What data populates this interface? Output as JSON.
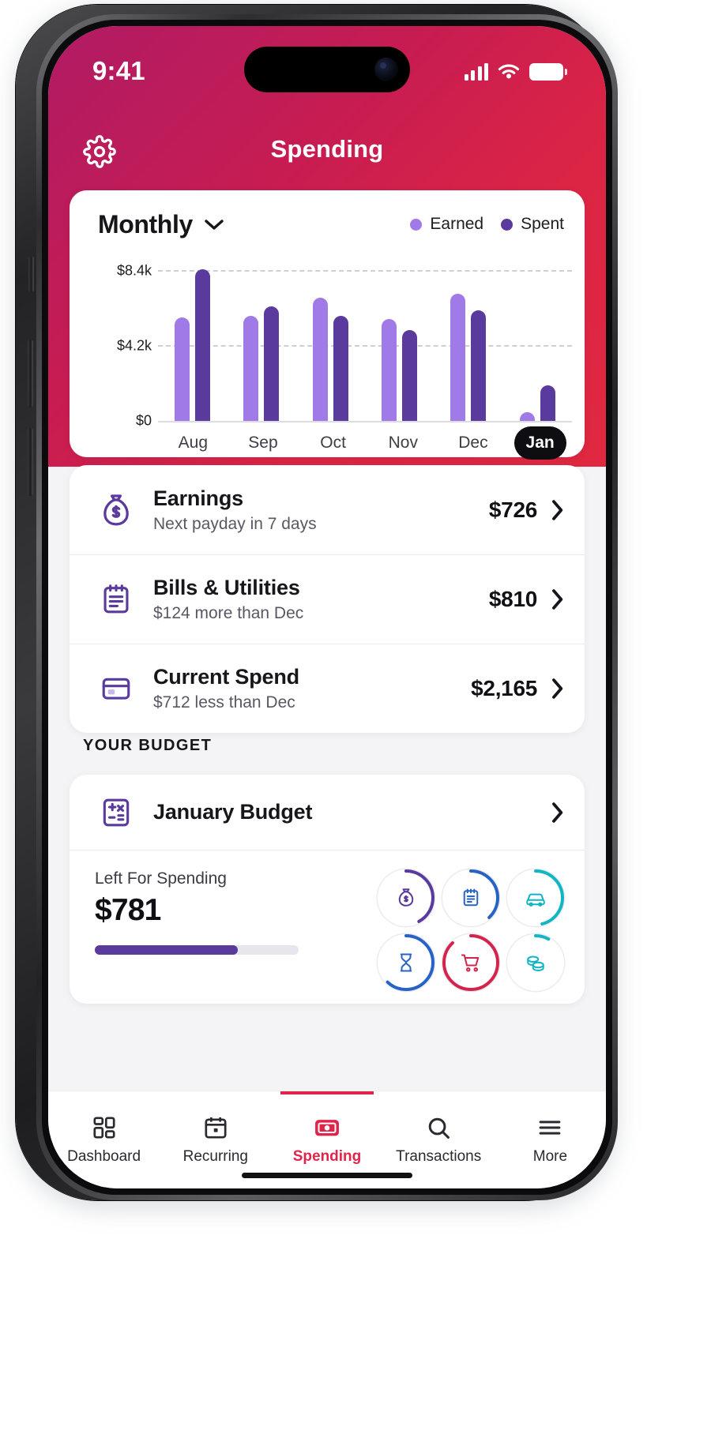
{
  "status_bar": {
    "time": "9:41",
    "signal_icon": "cellular-bars-icon",
    "wifi_icon": "wifi-icon",
    "battery_icon": "battery-icon"
  },
  "nav": {
    "title": "Spending",
    "settings_icon": "gear-icon"
  },
  "chart_card": {
    "period_label": "Monthly",
    "period_chevron_icon": "chevron-down-icon",
    "legend": [
      {
        "label": "Earned",
        "color": "#a07ae6"
      },
      {
        "label": "Spent",
        "color": "#5b3a9e"
      }
    ]
  },
  "chart_data": {
    "type": "bar",
    "title": "Monthly",
    "categories": [
      "Aug",
      "Sep",
      "Oct",
      "Nov",
      "Dec",
      "Jan"
    ],
    "series": [
      {
        "name": "Earned",
        "color": "#a07ae6",
        "values": [
          5800,
          5900,
          6900,
          5700,
          7100,
          500
        ]
      },
      {
        "name": "Spent",
        "color": "#5b3a9e",
        "values": [
          8500,
          6400,
          5900,
          5100,
          6200,
          2000
        ]
      }
    ],
    "ylabel": "",
    "xlabel": "",
    "ylim": [
      0,
      8400
    ],
    "yticks": [
      0,
      4200,
      8400
    ],
    "ytick_labels": [
      "$0",
      "$4.2k",
      "$8.4k"
    ],
    "grid": true,
    "legend_position": "top-right",
    "selected_category": "Jan"
  },
  "summary_rows": [
    {
      "icon": "money-bag-icon",
      "title": "Earnings",
      "subtitle": "Next payday in 7 days",
      "amount": "$726",
      "chevron_icon": "chevron-right-icon"
    },
    {
      "icon": "bill-clipboard-icon",
      "title": "Bills & Utilities",
      "subtitle": "$124 more than Dec",
      "amount": "$810",
      "chevron_icon": "chevron-right-icon"
    },
    {
      "icon": "wallet-card-icon",
      "title": "Current Spend",
      "subtitle": "$712 less than Dec",
      "amount": "$2,165",
      "chevron_icon": "chevron-right-icon"
    }
  ],
  "budget_section": {
    "heading": "YOUR BUDGET",
    "card_icon": "budget-calculator-icon",
    "card_title": "January Budget",
    "card_chevron_icon": "chevron-right-icon",
    "left_label": "Left For Spending",
    "left_amount": "$781",
    "progress_percent": 70,
    "progress_color": "#5b3a9e",
    "rings": [
      {
        "name": "money-bag-ring",
        "icon": "money-bag-icon",
        "color": "#5b3a9e",
        "percent": 42
      },
      {
        "name": "bills-ring",
        "icon": "clipboard-icon",
        "color": "#2763c7",
        "percent": 38
      },
      {
        "name": "transport-ring",
        "icon": "car-icon",
        "color": "#12b5c4",
        "percent": 46
      },
      {
        "name": "savings-ring",
        "icon": "hourglass-icon",
        "color": "#2763c7",
        "percent": 62
      },
      {
        "name": "groceries-ring",
        "icon": "shopping-cart-icon",
        "color": "#d4244e",
        "percent": 88
      },
      {
        "name": "other-ring",
        "icon": "coins-icon",
        "color": "#12b5c4",
        "percent": 8
      }
    ]
  },
  "tabs": [
    {
      "label": "Dashboard",
      "icon": "dashboard-grid-icon",
      "active": false
    },
    {
      "label": "Recurring",
      "icon": "calendar-icon",
      "active": false
    },
    {
      "label": "Spending",
      "icon": "banknote-icon",
      "active": true
    },
    {
      "label": "Transactions",
      "icon": "search-icon",
      "active": false
    },
    {
      "label": "More",
      "icon": "hamburger-menu-icon",
      "active": false
    }
  ],
  "colors": {
    "brand_red": "#e0254a",
    "brand_magenta": "#b01b64",
    "earned": "#a07ae6",
    "spent": "#5b3a9e"
  }
}
